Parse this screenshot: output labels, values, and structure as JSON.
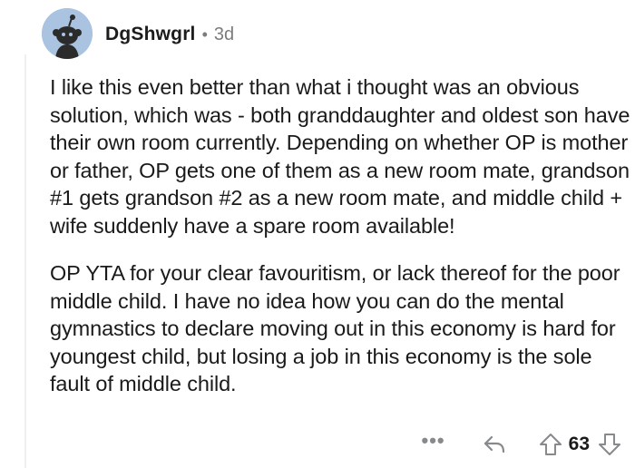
{
  "comment": {
    "username": "DgShwgrl",
    "separator": "•",
    "age": "3d",
    "paragraphs": [
      "I like this even better than what i thought was an obvious solution, which was - both granddaughter and oldest son have their own room currently. Depending on whether OP is mother or father, OP gets one of them as a new room mate, grandson #1 gets grandson #2 as a new room mate, and middle child + wife suddenly have a spare room available!",
      "OP YTA for your clear favouritism, or lack thereof for the poor middle child. I have no idea how you can do the mental gymnastics to declare moving out in this economy is hard for youngest child, but losing a job in this economy is the sole fault of middle child."
    ]
  },
  "actions": {
    "more": "•••",
    "score": "63",
    "icons": {
      "more": "more-options-icon",
      "reply": "reply-arrow-icon",
      "upvote": "upvote-arrow-icon",
      "downvote": "downvote-arrow-icon",
      "avatar": "snoo-avatar-icon"
    }
  },
  "colors": {
    "avatar_bg": "#a9c3e0",
    "text": "#1a1a1b",
    "muted": "#7c7c7c",
    "icon": "#878a8c"
  }
}
